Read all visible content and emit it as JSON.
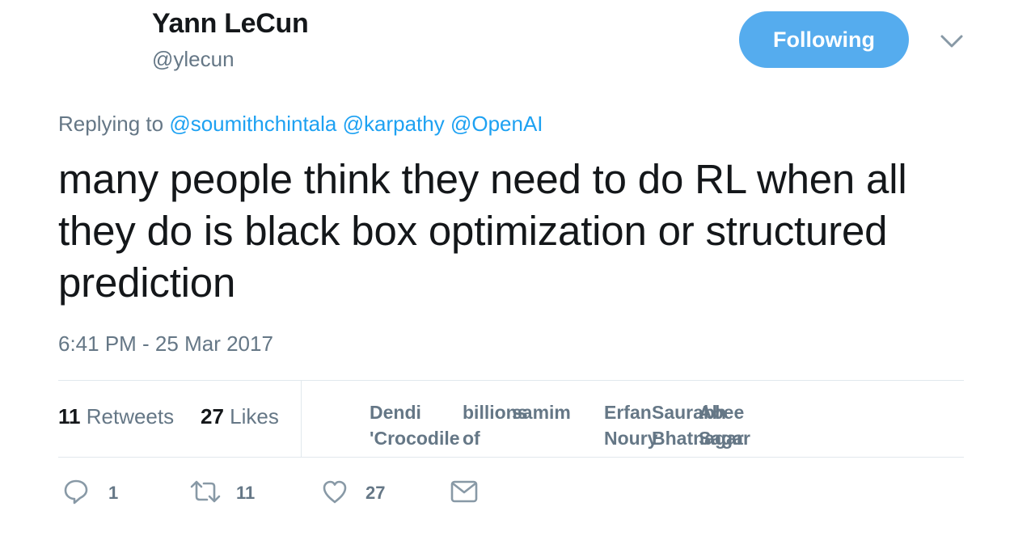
{
  "author": {
    "name": "Yann LeCun",
    "handle": "@ylecun"
  },
  "follow_button": {
    "label": "Following"
  },
  "reply_context": {
    "prefix": "Replying to",
    "mentions": [
      "@soumithchintala",
      "@karpathy",
      "@OpenAI"
    ]
  },
  "tweet": {
    "text": "many people think they need to do RL when all they do is black box optimization or structured prediction",
    "timestamp": "6:41 PM - 25 Mar 2017"
  },
  "stats": {
    "retweets_count": "11",
    "retweets_label": "Retweets",
    "likes_count": "27",
    "likes_label": "Likes"
  },
  "likers": [
    {
      "line1": "Dendi",
      "line2": "'Crocodile"
    },
    {
      "line1": "billions",
      "line2": "of"
    },
    {
      "line1": "samim",
      "line2": ""
    },
    {
      "line1": "Erfan",
      "line2": "Noury"
    },
    {
      "line1": "Saurabh",
      "line2": "Bhatnagar"
    },
    {
      "line1": "Abee",
      "line2": "Sagar"
    }
  ],
  "actions": {
    "reply_count": "1",
    "retweet_count": "11",
    "like_count": "27"
  },
  "colors": {
    "accent": "#1da1f2",
    "follow_bg": "#55acee",
    "muted": "#657786"
  }
}
